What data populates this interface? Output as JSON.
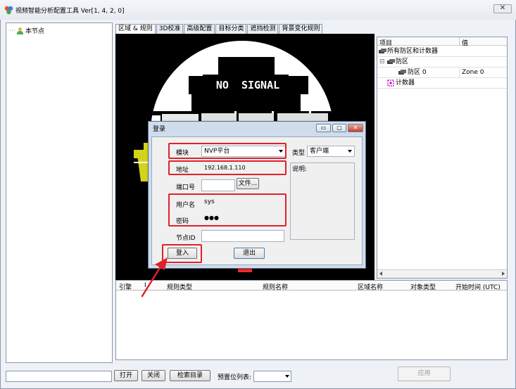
{
  "app": {
    "title": "视频智能分析配置工具 Ver[1, 4, 2, 0]",
    "close_glyph": "✕"
  },
  "tree": {
    "root_label": "本节点",
    "root_prefix": "⋯"
  },
  "tabs": [
    {
      "label": "区域 & 规则",
      "active": true
    },
    {
      "label": "3D校准"
    },
    {
      "label": "高级配置"
    },
    {
      "label": "目标分类"
    },
    {
      "label": "遮挡检测"
    },
    {
      "label": "背景变化规则"
    }
  ],
  "video": {
    "banner": "NO  SIGNAL"
  },
  "props": {
    "headers": [
      "项目",
      "值"
    ],
    "rows": [
      {
        "label": "所有防区和计数器",
        "value": "",
        "expander": ""
      },
      {
        "label": "防区",
        "value": "",
        "expander": "⊟"
      },
      {
        "label": "防区 0",
        "value": "Zone 0",
        "expander": ""
      },
      {
        "label": "计数器",
        "value": "",
        "expander": ""
      }
    ]
  },
  "grid": {
    "headers": [
      "引擎",
      "I",
      "规则类型",
      "规则名称",
      "区域名称",
      "对象类型",
      "开始时间 (UTC)"
    ]
  },
  "bottom": {
    "open": "打开",
    "close": "关闭",
    "search_dir": "检索目录",
    "preset_label": "预置位列表:",
    "preset_value": "",
    "apply": "应用"
  },
  "login": {
    "title": "登录",
    "controls": [
      "▭",
      "▢",
      "✕"
    ],
    "module_label": "模块",
    "module_value": "NVP平台",
    "type_label": "类型",
    "type_value": "客户端",
    "address_label": "地址",
    "address_value": "192.168.1.110",
    "port_label": "端口号",
    "port_value": "",
    "file_button": "文件...",
    "desc_label": "说明:",
    "user_label": "用户名",
    "user_value": "sys",
    "pass_label": "密码",
    "pass_value": "●●●",
    "node_label": "节点ID",
    "node_value": "",
    "login_button": "登入",
    "exit_button": "退出"
  },
  "colors": {
    "highlight": "#e0212a",
    "dialog_frame": "#cfdcec",
    "window_frame": "#eef1f6"
  }
}
